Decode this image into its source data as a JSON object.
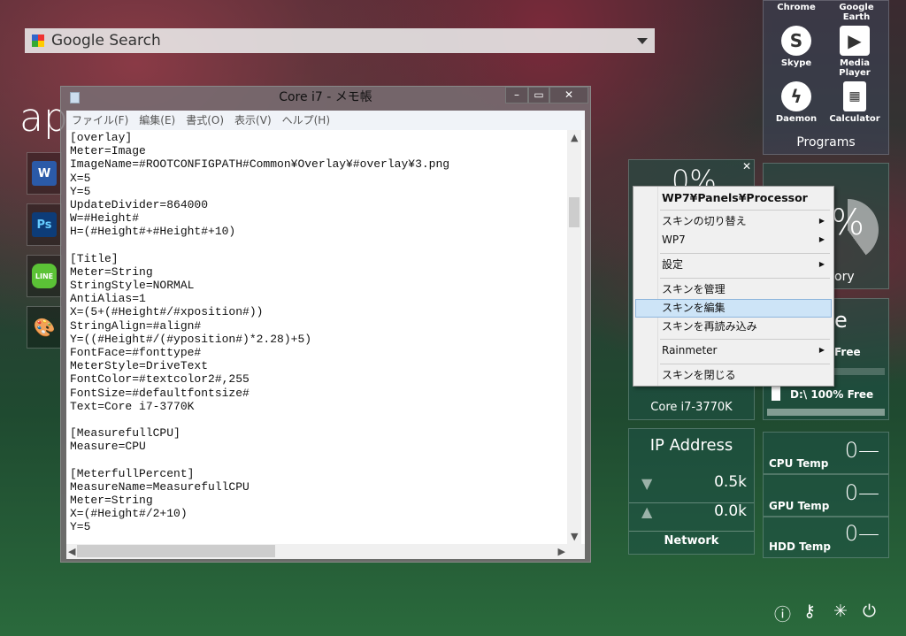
{
  "search": {
    "label": "Google Search"
  },
  "desktop": {
    "heading": "ap"
  },
  "apps": [
    {
      "name": "Word",
      "glyph": "W",
      "color": "#2b5aa8"
    },
    {
      "name": "Photoshop",
      "glyph": "Ps",
      "color": "#0d3c78"
    },
    {
      "name": "LINE",
      "glyph": "LINE",
      "color": "#5bc236"
    },
    {
      "name": "Paint",
      "glyph": "🎨",
      "color": "#d0d0d0"
    }
  ],
  "notepad": {
    "title": "Core i7 - メモ帳",
    "menu": [
      "ファイル(F)",
      "編集(E)",
      "書式(O)",
      "表示(V)",
      "ヘルプ(H)"
    ],
    "lines": [
      "[overlay]",
      "Meter=Image",
      "ImageName=#ROOTCONFIGPATH#Common¥Overlay¥#overlay¥3.png",
      "X=5",
      "Y=5",
      "UpdateDivider=864000",
      "W=#Height#",
      "H=(#Height#+#Height#+10)",
      "",
      "[Title]",
      "Meter=String",
      "StringStyle=NORMAL",
      "AntiAlias=1",
      "X=(5+(#Height#/#xposition#))",
      "StringAlign=#align#",
      "Y=((#Height#/(#yposition#)*2.28)+5)",
      "FontFace=#fonttype#",
      "MeterStyle=DriveText",
      "FontColor=#textcolor2#,255",
      "FontSize=#defaultfontsize#",
      "Text=Core i7-3770K",
      "",
      "[MeasurefullCPU]",
      "Measure=CPU",
      "",
      "[MeterfullPercent]",
      "MeasureName=MeasurefullCPU",
      "Meter=String",
      "X=(#Height#/2+10)",
      "Y=5"
    ]
  },
  "programs": {
    "title": "Programs",
    "items": [
      {
        "label": "Chrome"
      },
      {
        "label": "Google Earth"
      },
      {
        "label": "Skype",
        "icon": "skype-icon"
      },
      {
        "label": "Media Player",
        "icon": "play-icon"
      },
      {
        "label": "Daemon",
        "icon": "lightning-icon"
      },
      {
        "label": "Calculator",
        "icon": "calculator-icon"
      }
    ]
  },
  "processor": {
    "value": "0%",
    "label": "Core i7-3770K"
  },
  "memory": {
    "value": "%",
    "label": "ory"
  },
  "drives": {
    "title": "e",
    "c_label": "Free",
    "d_label": "D:\\ 100% Free",
    "d_free_percent": 100
  },
  "network": {
    "title": "IP Address",
    "down": "0.5k",
    "up": "0.0k",
    "label": "Network"
  },
  "temps": [
    {
      "label": "CPU Temp",
      "value": "0—"
    },
    {
      "label": "GPU Temp",
      "value": "0—"
    },
    {
      "label": "HDD Temp",
      "value": "0—"
    }
  ],
  "context_menu": {
    "header": "WP7¥Panels¥Processor",
    "items": [
      {
        "label": "スキンの切り替え",
        "sub": true
      },
      {
        "label": "WP7",
        "sub": true
      },
      {
        "label": "設定",
        "sub": true
      },
      {
        "label": "スキンを管理"
      },
      {
        "label": "スキンを編集",
        "highlighted": true
      },
      {
        "label": "スキンを再読み込み"
      },
      {
        "label": "Rainmeter",
        "sub": true
      },
      {
        "label": "スキンを閉じる"
      }
    ]
  },
  "system_icons": [
    "info-icon",
    "key-icon",
    "loading-icon",
    "power-icon"
  ]
}
